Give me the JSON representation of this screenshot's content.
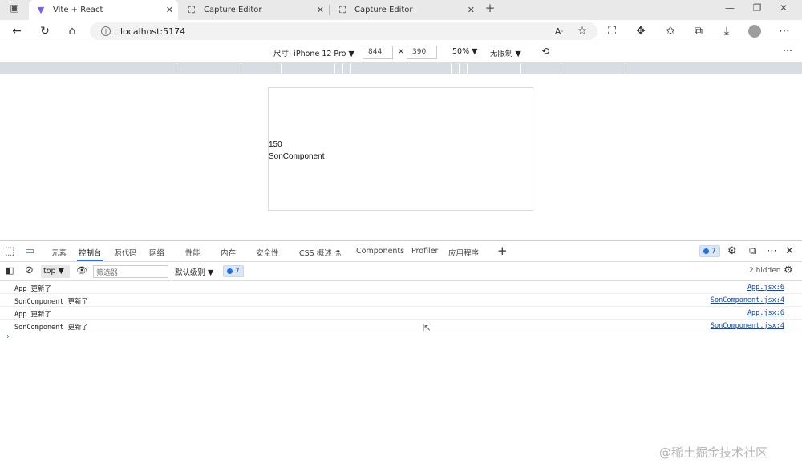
{
  "tabs": [
    {
      "icon": "vite-icon",
      "label": "Vite + React",
      "active": true
    },
    {
      "icon": "capture-icon",
      "label": "Capture Editor",
      "active": false
    },
    {
      "icon": "capture-icon",
      "label": "Capture Editor",
      "active": false
    }
  ],
  "address": {
    "url": "localhost:5174"
  },
  "device_toolbar": {
    "dimensions_label": "尺寸: iPhone 12 Pro",
    "width": "844",
    "times": "×",
    "height": "390",
    "zoom": "50%",
    "throttle": "无限制"
  },
  "page": {
    "count": "150",
    "component": "SonComponent"
  },
  "devtools": {
    "tabs": [
      "元素",
      "控制台",
      "源代码",
      "网络",
      "性能",
      "内存",
      "安全性",
      "CSS 概述",
      "Components",
      "Profiler",
      "应用程序"
    ],
    "active_tab": "控制台",
    "issues_count": "7",
    "console": {
      "context": "top",
      "filter_placeholder": "筛选器",
      "levels": "默认级别",
      "level_issues": "7",
      "hidden": "2 hidden",
      "messages": [
        {
          "text": "App 更新了",
          "source": "App.jsx:6"
        },
        {
          "text": "SonComponent 更新了",
          "source": "SonComponent.jsx:4"
        },
        {
          "text": "App 更新了",
          "source": "App.jsx:6"
        },
        {
          "text": "SonComponent 更新了",
          "source": "SonComponent.jsx:4"
        }
      ],
      "prompt": "›"
    }
  },
  "watermark": "@稀土掘金技术社区",
  "colors": {
    "accent": "#1a73e8",
    "link": "#1a45a8"
  }
}
